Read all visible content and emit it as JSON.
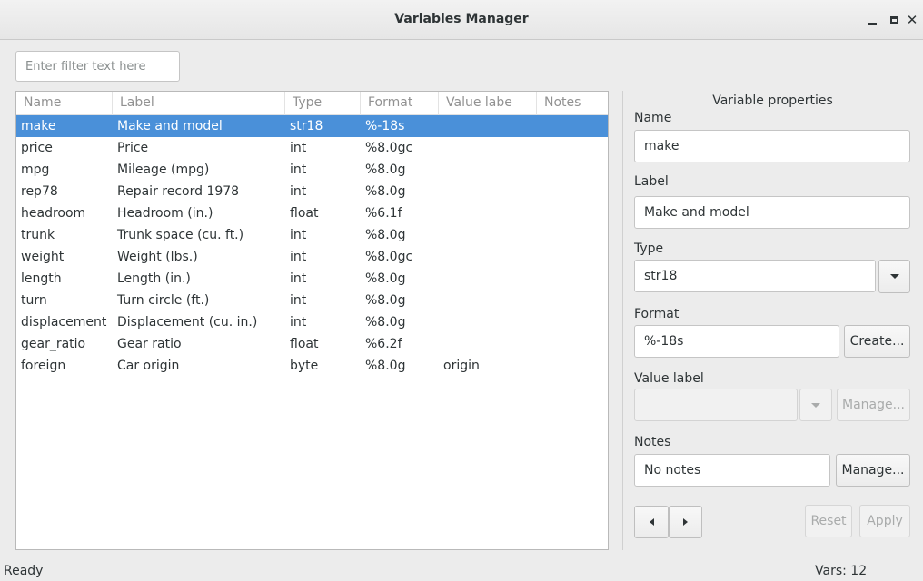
{
  "window": {
    "title": "Variables Manager",
    "controls": [
      "minimize-icon",
      "maximize-icon",
      "close-icon"
    ]
  },
  "filter": {
    "placeholder": "Enter filter text here",
    "value": ""
  },
  "table": {
    "columns": [
      "Name",
      "Label",
      "Type",
      "Format",
      "Value labe",
      "Notes"
    ],
    "selected_index": 0,
    "rows": [
      [
        "make",
        "Make and model",
        "str18",
        "%-18s",
        "",
        ""
      ],
      [
        "price",
        "Price",
        "int",
        "%8.0gc",
        "",
        ""
      ],
      [
        "mpg",
        "Mileage (mpg)",
        "int",
        "%8.0g",
        "",
        ""
      ],
      [
        "rep78",
        "Repair record 1978",
        "int",
        "%8.0g",
        "",
        ""
      ],
      [
        "headroom",
        "Headroom (in.)",
        "float",
        "%6.1f",
        "",
        ""
      ],
      [
        "trunk",
        "Trunk space (cu. ft.)",
        "int",
        "%8.0g",
        "",
        ""
      ],
      [
        "weight",
        "Weight (lbs.)",
        "int",
        "%8.0gc",
        "",
        ""
      ],
      [
        "length",
        "Length (in.)",
        "int",
        "%8.0g",
        "",
        ""
      ],
      [
        "turn",
        "Turn circle (ft.)",
        "int",
        "%8.0g",
        "",
        ""
      ],
      [
        "displacement",
        "Displacement (cu. in.)",
        "int",
        "%8.0g",
        "",
        ""
      ],
      [
        "gear_ratio",
        "Gear ratio",
        "float",
        "%6.2f",
        "",
        ""
      ],
      [
        "foreign",
        "Car origin",
        "byte",
        "%8.0g",
        "origin",
        ""
      ]
    ]
  },
  "properties": {
    "title": "Variable properties",
    "name_label": "Name",
    "name_value": "make",
    "label_label": "Label",
    "label_value": "Make and model",
    "type_label": "Type",
    "type_value": "str18",
    "format_label": "Format",
    "format_value": "%-18s",
    "create_button": "Create...",
    "value_label_label": "Value label",
    "value_label_value": "",
    "value_label_manage": "Manage...",
    "notes_label": "Notes",
    "notes_value": "No notes",
    "notes_manage": "Manage...",
    "reset_button": "Reset",
    "apply_button": "Apply"
  },
  "status": {
    "left": "Ready",
    "right": "Vars: 12"
  },
  "colors": {
    "selection": "#4a90d9",
    "background": "#ececec"
  }
}
